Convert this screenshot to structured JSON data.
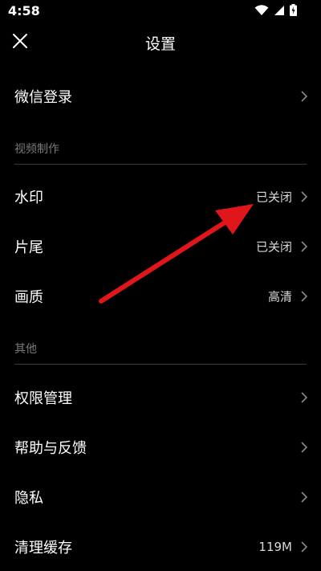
{
  "status_bar": {
    "time": "4:58"
  },
  "nav": {
    "title": "设置"
  },
  "rows_top": [
    {
      "label": "微信登录",
      "value": ""
    }
  ],
  "sections": [
    {
      "header": "视频制作",
      "items": [
        {
          "label": "水印",
          "value": "已关闭"
        },
        {
          "label": "片尾",
          "value": "已关闭"
        },
        {
          "label": "画质",
          "value": "高清"
        }
      ]
    },
    {
      "header": "其他",
      "items": [
        {
          "label": "权限管理",
          "value": ""
        },
        {
          "label": "帮助与反馈",
          "value": ""
        },
        {
          "label": "隐私",
          "value": ""
        },
        {
          "label": "清理缓存",
          "value": "119M"
        }
      ]
    }
  ],
  "annotation": {
    "color": "#e0161b"
  }
}
